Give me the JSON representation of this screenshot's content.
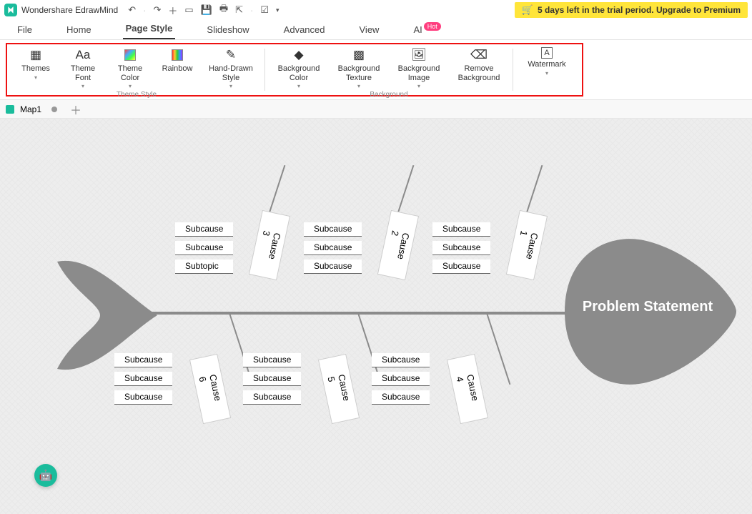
{
  "app": {
    "title": "Wondershare EdrawMind"
  },
  "trial": {
    "text": "5 days left in the trial period. Upgrade to Premium"
  },
  "menu": {
    "file": "File",
    "home": "Home",
    "pagestyle": "Page Style",
    "slideshow": "Slideshow",
    "advanced": "Advanced",
    "view": "View",
    "ai": "AI",
    "ai_badge": "Hot"
  },
  "ribbon": {
    "themes": "Themes",
    "themefont": "Theme Font",
    "themecolor": "Theme Color",
    "rainbow": "Rainbow",
    "handdrawn": "Hand-Drawn Style",
    "group_theme": "Theme Style",
    "bgcolor": "Background Color",
    "bgtexture": "Background Texture",
    "bgimage": "Background Image",
    "removebg": "Remove Background",
    "group_bg": "Background",
    "watermark": "Watermark"
  },
  "tabs": {
    "map1": "Map1"
  },
  "diagram": {
    "head": "Problem Statement",
    "c1": "Cause 1",
    "c2": "Cause 2",
    "c3": "Cause 3",
    "c4": "Cause 4",
    "c5": "Cause 5",
    "c6": "Cause 6",
    "top1": [
      "Subcause",
      "Subcause",
      "Subcause"
    ],
    "top2": [
      "Subcause",
      "Subcause",
      "Subcause"
    ],
    "top3": [
      "Subcause",
      "Subcause",
      "Subtopic"
    ],
    "bot4": [
      "Subcause",
      "Subcause",
      "Subcause"
    ],
    "bot5": [
      "Subcause",
      "Subcause",
      "Subcause"
    ],
    "bot6": [
      "Subcause",
      "Subcause",
      "Subcause"
    ]
  }
}
